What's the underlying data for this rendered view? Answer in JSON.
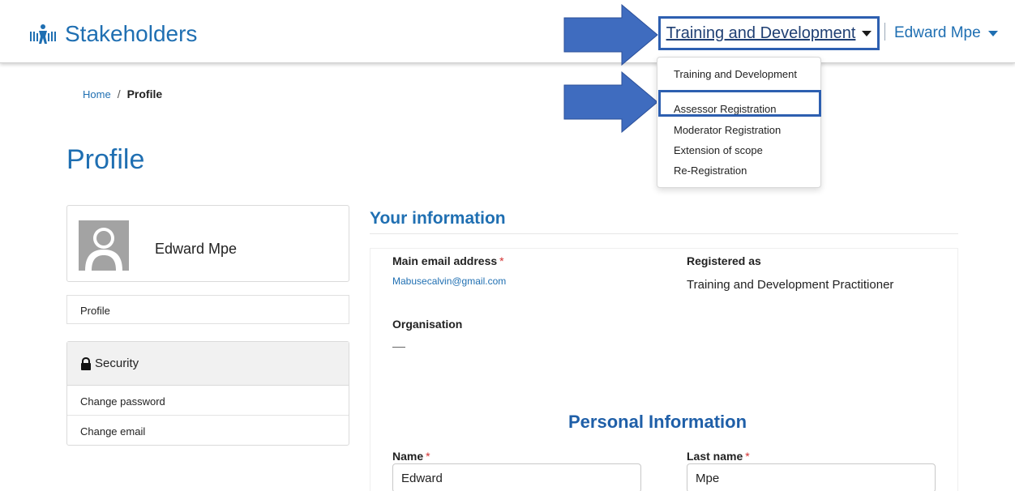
{
  "header": {
    "brand_title": "Stakeholders",
    "nav_dropdown_label": "Training and Development",
    "user_menu_label": "Edward Mpe"
  },
  "dropdown_menu": {
    "items": [
      "Training and Development",
      "Assessor Registration",
      "Moderator Registration",
      "Extension of scope",
      "Re-Registration"
    ],
    "highlighted_item": "Assessor Registration"
  },
  "breadcrumb": {
    "home": "Home",
    "separator": "/",
    "current": "Profile"
  },
  "page_title": "Profile",
  "sidebar": {
    "user_name": "Edward Mpe",
    "profile_link": "Profile",
    "security_heading": "Security",
    "security_items": [
      "Change password",
      "Change email"
    ]
  },
  "your_information": {
    "title": "Your information",
    "email_label": "Main email address",
    "email_value": "Mabusecalvin@gmail.com",
    "registered_label": "Registered as",
    "registered_value": "Training and Development Practitioner",
    "organisation_label": "Organisation",
    "organisation_value": "—"
  },
  "personal_information": {
    "title": "Personal Information",
    "name_label": "Name",
    "name_value": "Edward",
    "last_name_label": "Last name",
    "last_name_value": "Mpe"
  },
  "required_marker": "*",
  "colors": {
    "accent": "#1f6fb2",
    "highlight_border": "#2d5fb0",
    "arrow_fill": "#3f6cbf",
    "required": "#d32f2f"
  },
  "icons": [
    "stakeholders-logo-icon",
    "caret-down-icon",
    "lock-icon",
    "avatar-placeholder-icon",
    "arrow-right-icon"
  ]
}
